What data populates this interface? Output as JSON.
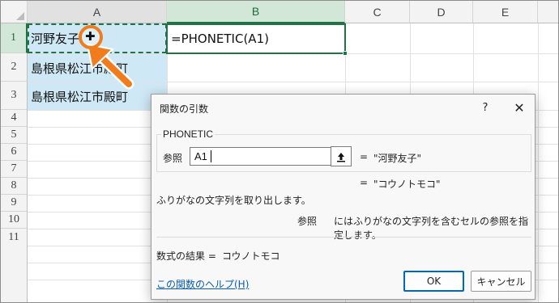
{
  "sheet": {
    "columns": [
      "A",
      "B",
      "C",
      "D",
      "E"
    ],
    "rows": [
      "1",
      "2",
      "3",
      "4",
      "5",
      "6",
      "7",
      "8",
      "9",
      "10",
      "11"
    ],
    "cells": {
      "a1": "河野友子",
      "a2": "島根県松江市殿町",
      "a3": "島根県松江市殿町",
      "b1": "=PHONETIC(A1)"
    },
    "selected_column": "B",
    "selected_row": "1",
    "accent_color": "#217346",
    "highlight_color": "#cfe8f5"
  },
  "cursor": {
    "icon": "plus-cursor-icon",
    "ring_color": "#f07c1e"
  },
  "dialog": {
    "title": "関数の引数",
    "help_label": "?",
    "close_label": "✕",
    "function_name": "PHONETIC",
    "argument_label": "参照",
    "argument_value": "A1",
    "collapse_icon": "collapse-dialog-icon",
    "equals": "=",
    "argument_result": "\"河野友子\"",
    "function_result": "\"コウノトモコ\"",
    "description": "ふりがなの文字列を取り出します。",
    "argument_desc_name": "参照",
    "argument_desc": "にはふりがなの文字列を含むセルの参照を指定します。",
    "formula_result_label": "数式の結果 =",
    "formula_result_value": "コウノトモコ",
    "help_link": "この関数のヘルプ(H)",
    "ok_label": "OK",
    "cancel_label": "キャンセル"
  },
  "annotations": {
    "arrow_color": "#f07c1e",
    "arrows": [
      "arrow-pointing-to-cell-a1",
      "arrow-pointing-to-reference-field"
    ]
  }
}
